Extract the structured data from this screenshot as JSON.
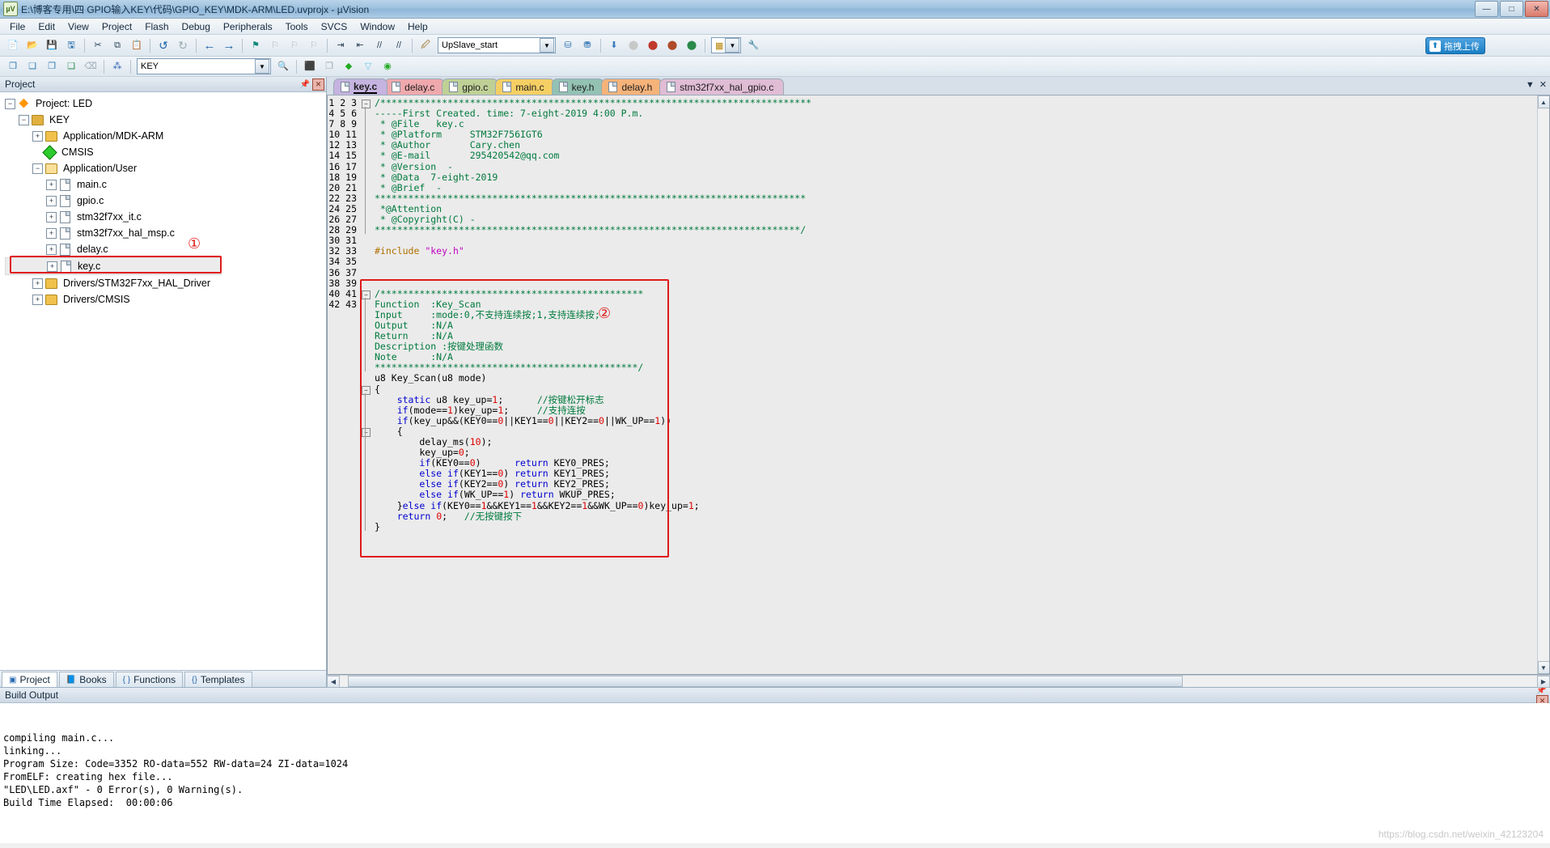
{
  "window": {
    "title": "E:\\博客专用\\四 GPIO输入KEY\\代码\\GPIO_KEY\\MDK-ARM\\LED.uvprojx - µVision",
    "app_icon": "uvision-icon",
    "minimize": "—",
    "maximize": "□",
    "close": "✕"
  },
  "menu": {
    "items": [
      "File",
      "Edit",
      "View",
      "Project",
      "Flash",
      "Debug",
      "Peripherals",
      "Tools",
      "SVCS",
      "Window",
      "Help"
    ]
  },
  "toolbar1": {
    "buttons": [
      "new-file-icon",
      "open-file-icon",
      "save-icon",
      "save-all-icon",
      "cut-icon",
      "copy-icon",
      "paste-icon",
      "undo-icon",
      "redo-icon",
      "navigate-back-icon",
      "navigate-forward-icon",
      "bookmark-toggle-icon",
      "bookmark-prev-icon",
      "bookmark-next-icon",
      "bookmark-clear-icon",
      "indent-icon",
      "outdent-icon",
      "comment-icon",
      "uncomment-icon"
    ],
    "target_combo_value": "UpSlave_start",
    "target_options": [
      "UpSlave_start"
    ],
    "right_buttons": [
      "target-options-icon",
      "build-icon",
      "rebuild-icon",
      "batch-build-icon",
      "download-icon",
      "start-debug-icon",
      "configure-icon"
    ],
    "upload_pill_label": "拖拽上传"
  },
  "toolbar2": {
    "buttons": [
      "project-window-icon",
      "books-icon",
      "functions-icon",
      "templates-icon",
      "find-in-files-icon",
      "search-icon"
    ],
    "search_value": "KEY",
    "right_buttons": [
      "manage-runtime-icon",
      "pack-installer-icon",
      "configure-flash-icon",
      "debug-settings-icon",
      "memory-map-icon"
    ]
  },
  "project_panel": {
    "title": "Project",
    "pin_icon": "pin-icon",
    "close_icon": "close-icon",
    "tree": [
      {
        "label": "Project: LED",
        "icon": "project-icon",
        "expander": "−",
        "indent": 0
      },
      {
        "label": "KEY",
        "icon": "target-icon",
        "expander": "−",
        "indent": 1
      },
      {
        "label": "Application/MDK-ARM",
        "icon": "folder-icon",
        "expander": "+",
        "indent": 2
      },
      {
        "label": "CMSIS",
        "icon": "cmsis-icon",
        "expander": "",
        "indent": 2
      },
      {
        "label": "Application/User",
        "icon": "folder-open-icon",
        "expander": "−",
        "indent": 2
      },
      {
        "label": "main.c",
        "icon": "c-file-icon",
        "expander": "+",
        "indent": 3
      },
      {
        "label": "gpio.c",
        "icon": "c-file-icon",
        "expander": "+",
        "indent": 3
      },
      {
        "label": "stm32f7xx_it.c",
        "icon": "c-file-icon",
        "expander": "+",
        "indent": 3
      },
      {
        "label": "stm32f7xx_hal_msp.c",
        "icon": "c-file-icon",
        "expander": "+",
        "indent": 3
      },
      {
        "label": "delay.c",
        "icon": "c-file-icon",
        "expander": "+",
        "indent": 3
      },
      {
        "label": "key.c",
        "icon": "c-file-icon",
        "expander": "+",
        "indent": 3,
        "selected": true
      },
      {
        "label": "Drivers/STM32F7xx_HAL_Driver",
        "icon": "folder-icon",
        "expander": "+",
        "indent": 2
      },
      {
        "label": "Drivers/CMSIS",
        "icon": "folder-icon",
        "expander": "+",
        "indent": 2
      }
    ],
    "bottom_tabs": [
      {
        "label": "Project",
        "icon": "project-tab-icon",
        "active": true
      },
      {
        "label": "Books",
        "icon": "books-tab-icon",
        "active": false
      },
      {
        "label": "Functions",
        "icon": "functions-tab-icon",
        "active": false
      },
      {
        "label": "Templates",
        "icon": "templates-tab-icon",
        "active": false
      }
    ]
  },
  "annotations": {
    "marker1": "①",
    "marker2": "②",
    "color": "#e01a1a"
  },
  "editor": {
    "tabs": [
      {
        "label": "key.c",
        "color": "#c5b3e0",
        "active": true
      },
      {
        "label": "delay.c",
        "color": "#efa9ad",
        "active": false
      },
      {
        "label": "gpio.c",
        "color": "#bfd096",
        "active": false
      },
      {
        "label": "main.c",
        "color": "#f5cf64",
        "active": false
      },
      {
        "label": "key.h",
        "color": "#93c2b3",
        "active": false
      },
      {
        "label": "delay.h",
        "color": "#f5b37a",
        "active": false
      },
      {
        "label": "stm32f7xx_hal_gpio.c",
        "color": "#e0bcd5",
        "active": false
      }
    ],
    "tab_controls": [
      "tab-list-dropdown-icon",
      "close-tab-icon"
    ],
    "first_line": 1,
    "last_line": 43,
    "lines": [
      {
        "n": 1,
        "text": "/*****************************************************************************"
      },
      {
        "n": 2,
        "text": "-----First Created. time: 7-eight-2019 4:00 P.m."
      },
      {
        "n": 3,
        "text": " * @File   key.c"
      },
      {
        "n": 4,
        "text": " * @Platform     STM32F756IGT6"
      },
      {
        "n": 5,
        "text": " * @Author       Cary.chen"
      },
      {
        "n": 6,
        "text": " * @E-mail       295420542@qq.com"
      },
      {
        "n": 7,
        "text": " * @Version  -"
      },
      {
        "n": 8,
        "text": " * @Data  7-eight-2019"
      },
      {
        "n": 9,
        "text": " * @Brief  -"
      },
      {
        "n": 10,
        "text": "*****************************************************************************"
      },
      {
        "n": 11,
        "text": " *@Attention"
      },
      {
        "n": 12,
        "text": " * @Copyright(C) -"
      },
      {
        "n": 13,
        "text": "****************************************************************************/"
      },
      {
        "n": 14,
        "text": ""
      },
      {
        "n": 15,
        "text": "#include \"key.h\""
      },
      {
        "n": 16,
        "text": ""
      },
      {
        "n": 17,
        "text": ""
      },
      {
        "n": 18,
        "text": ""
      },
      {
        "n": 19,
        "text": "/***********************************************"
      },
      {
        "n": 20,
        "text": "Function  :Key_Scan"
      },
      {
        "n": 21,
        "text": "Input     :mode:0,不支持连续按;1,支持连续按;"
      },
      {
        "n": 22,
        "text": "Output    :N/A"
      },
      {
        "n": 23,
        "text": "Return    :N/A"
      },
      {
        "n": 24,
        "text": "Description :按键处理函数"
      },
      {
        "n": 25,
        "text": "Note      :N/A"
      },
      {
        "n": 26,
        "text": "***********************************************/"
      },
      {
        "n": 27,
        "text": "u8 Key_Scan(u8 mode)"
      },
      {
        "n": 28,
        "text": "{"
      },
      {
        "n": 29,
        "text": "    static u8 key_up=1;      //按键松开标志"
      },
      {
        "n": 30,
        "text": "    if(mode==1)key_up=1;     //支持连按"
      },
      {
        "n": 31,
        "text": "    if(key_up&&(KEY0==0||KEY1==0||KEY2==0||WK_UP==1))"
      },
      {
        "n": 32,
        "text": "    {"
      },
      {
        "n": 33,
        "text": "        delay_ms(10);"
      },
      {
        "n": 34,
        "text": "        key_up=0;"
      },
      {
        "n": 35,
        "text": "        if(KEY0==0)      return KEY0_PRES;"
      },
      {
        "n": 36,
        "text": "        else if(KEY1==0) return KEY1_PRES;"
      },
      {
        "n": 37,
        "text": "        else if(KEY2==0) return KEY2_PRES;"
      },
      {
        "n": 38,
        "text": "        else if(WK_UP==1) return WKUP_PRES;"
      },
      {
        "n": 39,
        "text": "    }else if(KEY0==1&&KEY1==1&&KEY2==1&&WK_UP==0)key_up=1;"
      },
      {
        "n": 40,
        "text": "    return 0;   //无按键按下"
      },
      {
        "n": 41,
        "text": "}"
      },
      {
        "n": 42,
        "text": ""
      },
      {
        "n": 43,
        "text": ""
      }
    ]
  },
  "build_output": {
    "title": "Build Output",
    "pin_icon": "pin-icon",
    "close_icon": "close-icon",
    "lines": [
      "compiling main.c...",
      "linking...",
      "Program Size: Code=3352 RO-data=552 RW-data=24 ZI-data=1024",
      "FromELF: creating hex file...",
      "\"LED\\LED.axf\" - 0 Error(s), 0 Warning(s).",
      "Build Time Elapsed:  00:00:06"
    ],
    "watermark": "https://blog.csdn.net/weixin_42123204"
  }
}
